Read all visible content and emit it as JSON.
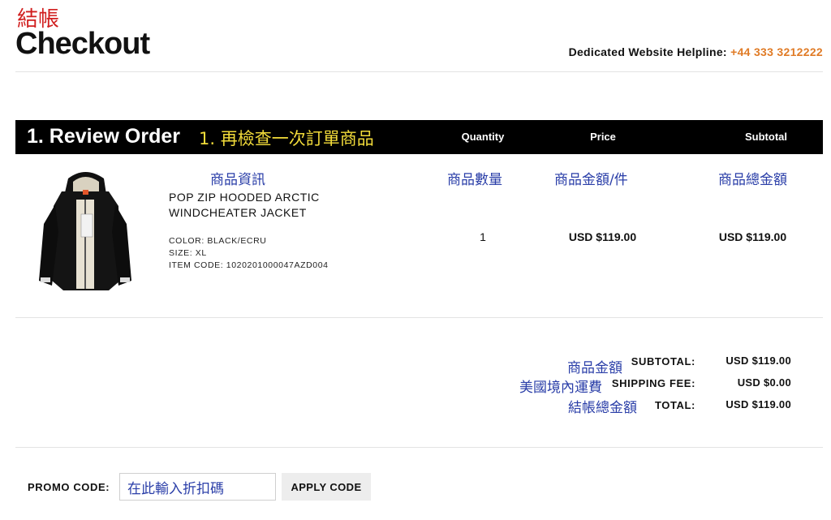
{
  "header": {
    "title_zh": "結帳",
    "title": "Checkout",
    "helpline_label": "Dedicated Website Helpline:",
    "helpline_phone": "+44 333 3212222"
  },
  "order": {
    "section_title": "1. Review Order",
    "section_title_zh": "1. 再檢查一次訂單商品",
    "columns": {
      "quantity": "Quantity",
      "price": "Price",
      "subtotal": "Subtotal"
    },
    "annotations_zh": {
      "product_info": "商品資訊",
      "quantity": "商品數量",
      "unit_price": "商品金額/件",
      "total": "商品總金額"
    },
    "item": {
      "image": "black-hooded-jacket",
      "name": "POP ZIP HOODED ARCTIC WINDCHEATER JACKET",
      "color": "COLOR: BLACK/ECRU",
      "size": "SIZE: XL",
      "item_code": "ITEM CODE: 1020201000047AZD004",
      "quantity": "1",
      "price": "USD $119.00",
      "subtotal": "USD $119.00"
    }
  },
  "totals": {
    "subtotal": {
      "zh": "商品金額",
      "label": "SUBTOTAL:",
      "value": "USD $119.00"
    },
    "shipping": {
      "zh": "美國境內運費",
      "label": "SHIPPING FEE:",
      "value": "USD $0.00"
    },
    "total": {
      "zh": "結帳總金額",
      "label": "TOTAL:",
      "value": "USD $119.00"
    }
  },
  "promo": {
    "label": "PROMO CODE:",
    "input_value": "在此輸入折扣碼",
    "apply_label": "APPLY CODE"
  },
  "colors": {
    "accent_phone": "#e07b26",
    "bar_bg": "#000000",
    "zh_yellow": "#f3dc3a",
    "zh_blue": "#2a3ea8",
    "zh_red": "#d11f1f"
  }
}
